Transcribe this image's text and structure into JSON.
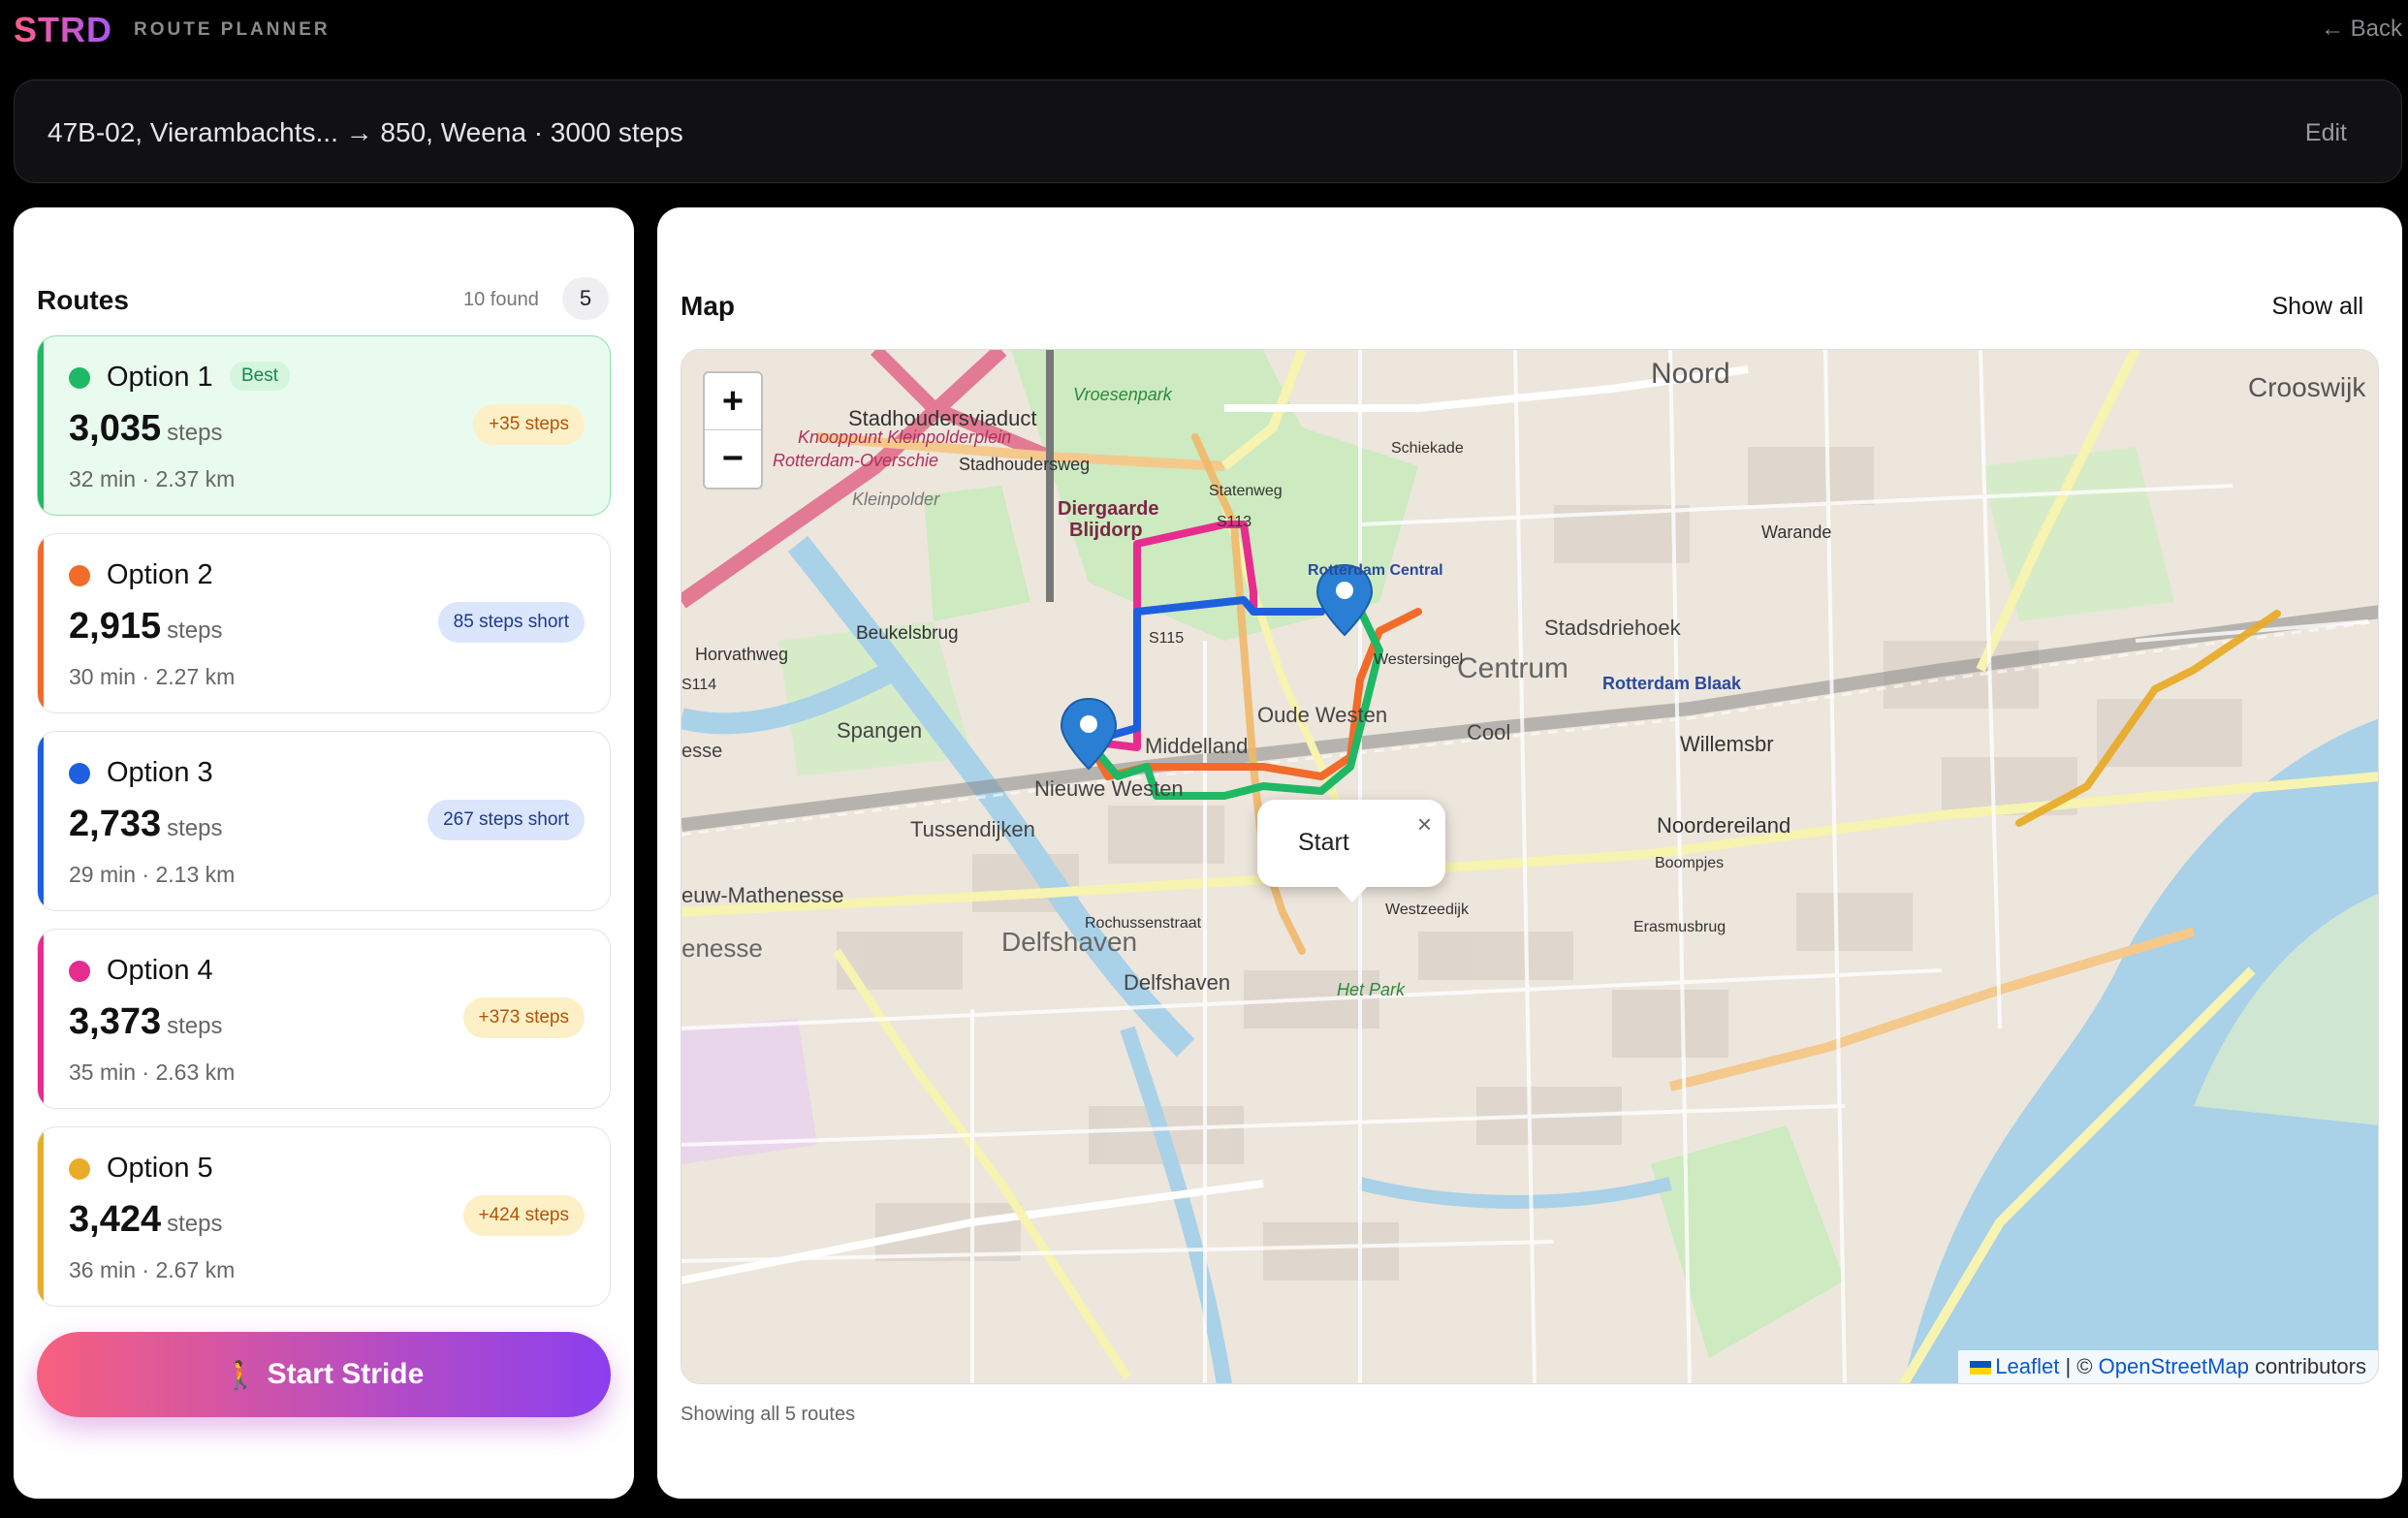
{
  "header": {
    "brand": "STRD",
    "subtitle": "ROUTE PLANNER",
    "back_label": "← Back"
  },
  "summary": {
    "text": "47B-02, Vierambachts... → 850, Weena · 3000 steps",
    "edit_label": "Edit"
  },
  "routes": {
    "title": "Routes",
    "found_label": "10 found",
    "count": "5",
    "items": [
      {
        "name": "Option 1",
        "tag": "Best",
        "steps": "3,035",
        "unit": "steps",
        "meta": "32 min · 2.37 km",
        "delta": "+35 steps",
        "delta_kind": "over",
        "color": "#1fb864"
      },
      {
        "name": "Option 2",
        "steps": "2,915",
        "unit": "steps",
        "meta": "30 min · 2.27 km",
        "delta": "85 steps short",
        "delta_kind": "under",
        "color": "#f26b2a"
      },
      {
        "name": "Option 3",
        "steps": "2,733",
        "unit": "steps",
        "meta": "29 min · 2.13 km",
        "delta": "267 steps short",
        "delta_kind": "under",
        "color": "#1e5fe0"
      },
      {
        "name": "Option 4",
        "steps": "3,373",
        "unit": "steps",
        "meta": "35 min · 2.63 km",
        "delta": "+373 steps",
        "delta_kind": "over",
        "color": "#e62d8f"
      },
      {
        "name": "Option 5",
        "steps": "3,424",
        "unit": "steps",
        "meta": "36 min · 2.67 km",
        "delta": "+424 steps",
        "delta_kind": "over",
        "color": "#e8ac2a"
      }
    ],
    "start_button": "Start Stride",
    "start_icon": "🚶"
  },
  "map": {
    "title": "Map",
    "show_all_label": "Show all",
    "footer": "Showing all 5 routes",
    "zoom_in": "+",
    "zoom_out": "−",
    "popup_text": "Start",
    "popup_close": "×",
    "attribution_leaflet": "Leaflet",
    "attribution_sep": " | © ",
    "attribution_osm": "OpenStreetMap",
    "attribution_tail": " contributors",
    "place_labels": {
      "noord": "Noord",
      "crooswijk": "Crooswijk",
      "stadhoudersviaduct": "Stadhoudersviaduct",
      "knooppunt": "Knooppunt Kleinpolderplein",
      "overschie": "Rotterdam-Overschie",
      "stadhoudersweg": "Stadhoudersweg",
      "vroesenpark": "Vroesenpark",
      "diergaarde": "Diergaarde",
      "blijdorp": "Blijdorp",
      "kleinpolder": "Kleinpolder",
      "beukelsbrug": "Beukelsbrug",
      "horvathweg": "Horvathweg",
      "spangen": "Spangen",
      "middelland": "Middelland",
      "nieuwe_westen": "Nieuwe Westen",
      "oude_westen": "Oude Westen",
      "centrum": "Centrum",
      "stadsdriehoek": "Stadsdriehoek",
      "rotterdam_blaak": "Rotterdam Blaak",
      "cool": "Cool",
      "willemsbrug": "Willemsbr",
      "tussendijken": "Tussendijken",
      "mathenesse": "euw-Mathenesse",
      "delfshaven": "Delfshaven",
      "delfshaven2": "Delfshaven",
      "noordereiland": "Noordereiland",
      "warande": "Warande",
      "het_park": "Het Park",
      "rochussenstraat": "Rochussenstraat",
      "westzeedijk": "Westzeedijk",
      "statenweg": "Statenweg",
      "schiekade": "Schiekade",
      "westersingel": "Westersingel",
      "enesse": "enesse",
      "esse": "esse",
      "boompjes": "Boompjes",
      "erasmusbrug": "Erasmusbrug",
      "s115": "S115",
      "s114": "S114",
      "s113": "S113",
      "rotterdam_central": "Rotterdam Central"
    }
  }
}
